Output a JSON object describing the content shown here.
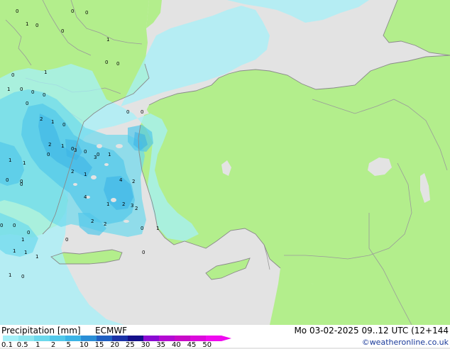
{
  "product": {
    "title": "Precipitation [mm]",
    "model": "ECMWF",
    "valid_time": "Mo 03-02-2025 09..12 UTC (12+144",
    "credit": "©weatheronline.co.uk"
  },
  "legend": {
    "ticks": [
      "0.1",
      "0.5",
      "1",
      "2",
      "5",
      "10",
      "15",
      "20",
      "25",
      "30",
      "35",
      "40",
      "45",
      "50"
    ],
    "colors": [
      "#a5f0f8",
      "#8ce6f0",
      "#6cd8ec",
      "#52c8ea",
      "#3cb4e6",
      "#2a8ed6",
      "#1f5fc2",
      "#1b33a8",
      "#140f8a",
      "#8a0ad2",
      "#b40ad2",
      "#c80ac8",
      "#dc0adc",
      "#f00af0"
    ],
    "arrow_color": "#f00af0"
  },
  "map_colors": {
    "sea": "#e3e3e3",
    "land": "#b3ee8c",
    "border": "#9a9a9a",
    "coast": "#8a8a8a"
  },
  "map_labels": [
    "0",
    "0",
    "0",
    "1",
    "0",
    "0",
    "1",
    "0",
    "0",
    "0",
    "1",
    "1",
    "0",
    "0",
    "0",
    "0",
    "2",
    "1",
    "0",
    "2",
    "1",
    "0",
    "4",
    "2",
    "0",
    "3",
    "0",
    "0",
    "1",
    "2",
    "1",
    "0",
    "4",
    "2",
    "2",
    "3",
    "1",
    "2",
    "2",
    "3",
    "1",
    "1",
    "0",
    "0",
    "0",
    "0",
    "1",
    "1",
    "0",
    "0",
    "1",
    "1",
    "1",
    "0",
    "1",
    "0",
    "0",
    "0",
    "0"
  ]
}
